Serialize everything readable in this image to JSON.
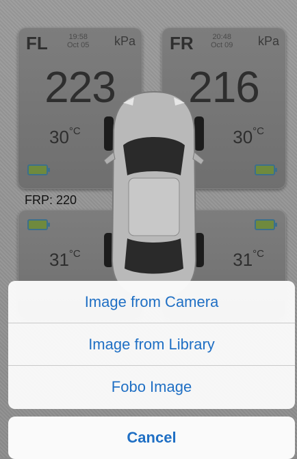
{
  "tiles": {
    "fl": {
      "position": "FL",
      "time": "19:58",
      "date": "Oct 05",
      "unit": "kPa",
      "pressure": "223",
      "temp": "30",
      "temp_unit": "°C"
    },
    "fr": {
      "position": "FR",
      "time": "20:48",
      "date": "Oct 09",
      "unit": "kPa",
      "pressure": "216",
      "temp": "30",
      "temp_unit": "°C"
    },
    "rl": {
      "temp": "31",
      "temp_unit": "°C"
    },
    "rr": {
      "temp": "31",
      "temp_unit": "°C"
    }
  },
  "frp_label": "FRP: 220",
  "action_sheet": {
    "options": [
      "Image from Camera",
      "Image from Library",
      "Fobo Image"
    ],
    "cancel_label": "Cancel"
  },
  "colors": {
    "accent": "#1f6fc4",
    "battery_border": "#3c6f8c",
    "battery_fill": "#6f8a3e"
  }
}
